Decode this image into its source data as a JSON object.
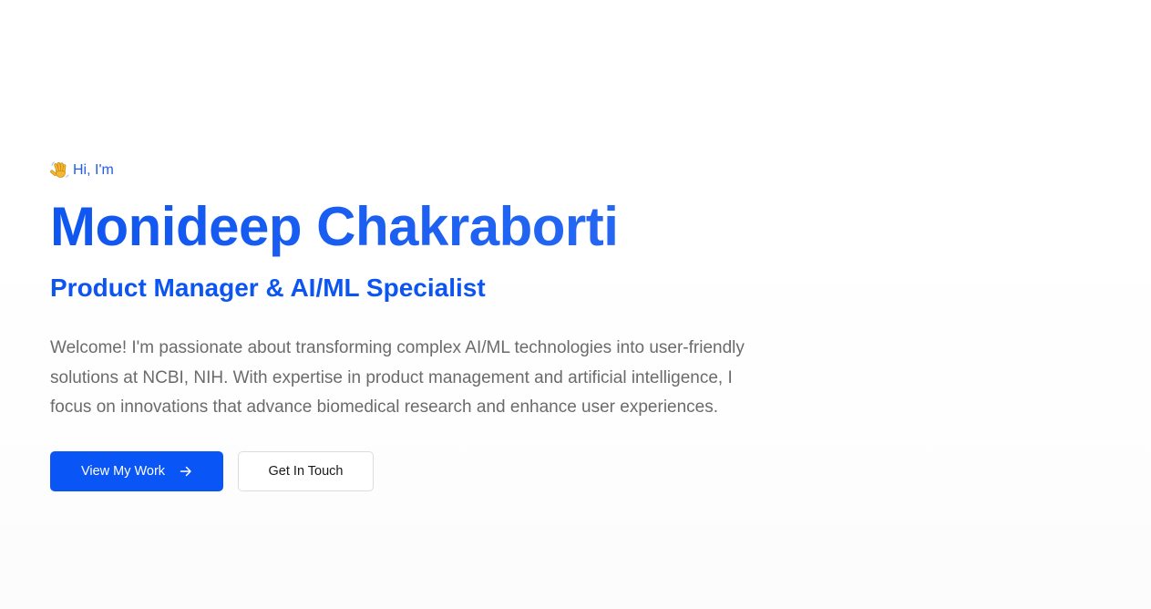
{
  "hero": {
    "greeting": "Hi, I'm",
    "greeting_icon": "waving-hand-icon",
    "name": "Monideep Chakraborti",
    "subtitle": "Product Manager & AI/ML Specialist",
    "intro": "Welcome! I'm passionate about transforming complex AI/ML technologies into user-friendly solutions at NCBI, NIH. With expertise in product management and artificial intelligence, I focus on innovations that advance biomedical research and enhance user experiences."
  },
  "actions": {
    "primary_label": "View My Work",
    "primary_icon": "arrow-right-icon",
    "secondary_label": "Get In Touch"
  },
  "colors": {
    "accent": "#0a55f5",
    "body_text": "#6b6b6b"
  }
}
